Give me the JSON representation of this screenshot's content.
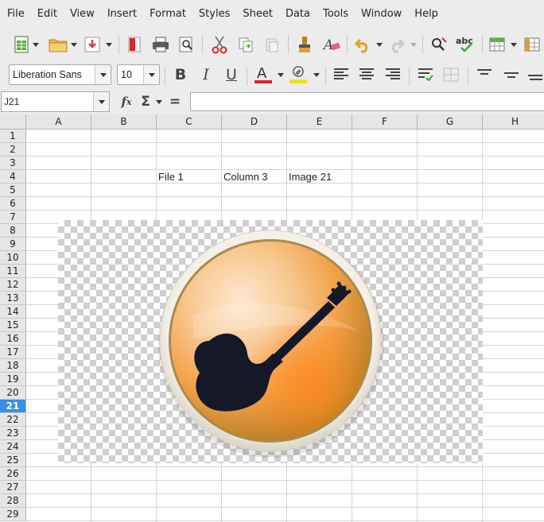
{
  "menu": [
    "File",
    "Edit",
    "View",
    "Insert",
    "Format",
    "Styles",
    "Sheet",
    "Data",
    "Tools",
    "Window",
    "Help"
  ],
  "format_toolbar": {
    "font_name": "Liberation Sans",
    "font_size": "10"
  },
  "formula_bar": {
    "cell_reference": "J21",
    "formula_value": ""
  },
  "columns": [
    "A",
    "B",
    "C",
    "D",
    "E",
    "F",
    "G",
    "H"
  ],
  "rows": [
    "1",
    "2",
    "3",
    "4",
    "5",
    "6",
    "7",
    "8",
    "9",
    "10",
    "11",
    "12",
    "13",
    "14",
    "15",
    "16",
    "17",
    "18",
    "19",
    "20",
    "21",
    "22",
    "23",
    "24",
    "25",
    "26",
    "27",
    "28",
    "29"
  ],
  "active_row": "21",
  "cells": {
    "c4": "File 1",
    "d4": "Column 3",
    "e4": "Image 21"
  },
  "colors": {
    "accent": "#3a8ee6",
    "guitar_badge_outer": "#f0ead8",
    "guitar_silhouette": "#141828"
  },
  "image_icon": "guitar-app-icon"
}
